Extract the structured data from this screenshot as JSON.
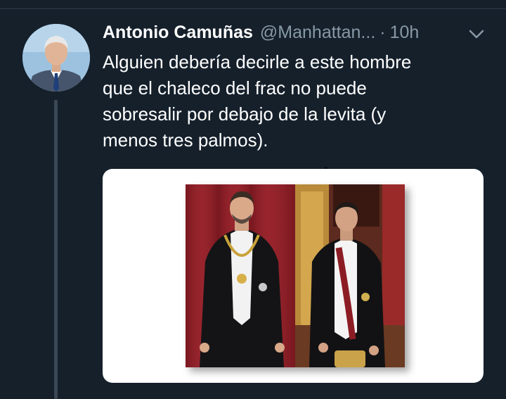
{
  "tweet": {
    "author_name": "Antonio Camuñas",
    "handle": "@Manhattan...",
    "separator": "·",
    "time": "10h",
    "text_lines": [
      "Alguien debería decirle a este hombre",
      "que el chaleco del frac no puede",
      "sobresalir por debajo de la levita (y",
      "menos tres palmos)."
    ]
  },
  "icons": {
    "menu": "chevron-down-icon"
  },
  "colors": {
    "background": "#15202b",
    "secondary_text": "#8899a6",
    "divider": "#2f3b47",
    "thread_line": "#3a4754"
  }
}
